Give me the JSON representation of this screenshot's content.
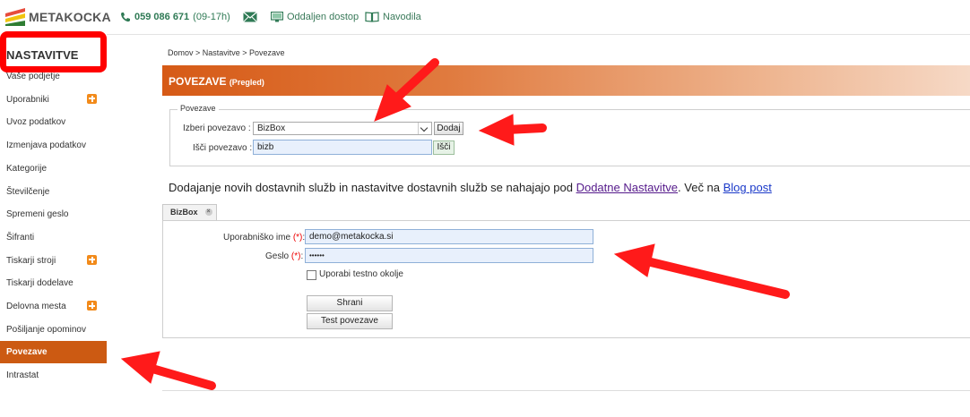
{
  "topbar": {
    "brand": "METAKOCKA",
    "phone_number": "059 086 671",
    "phone_hours": "(09-17h)",
    "remote_access": "Oddaljen dostop",
    "manuals": "Navodila"
  },
  "sidebar": {
    "title": "NASTAVITVE",
    "items": [
      {
        "label": "Vaše podjetje",
        "plus": false,
        "active": false
      },
      {
        "label": "Uporabniki",
        "plus": true,
        "active": false
      },
      {
        "label": "Uvoz podatkov",
        "plus": false,
        "active": false
      },
      {
        "label": "Izmenjava podatkov",
        "plus": false,
        "active": false
      },
      {
        "label": "Kategorije",
        "plus": false,
        "active": false
      },
      {
        "label": "Številčenje",
        "plus": false,
        "active": false
      },
      {
        "label": "Spremeni geslo",
        "plus": false,
        "active": false
      },
      {
        "label": "Šifranti",
        "plus": false,
        "active": false
      },
      {
        "label": "Tiskarji stroji",
        "plus": true,
        "active": false
      },
      {
        "label": "Tiskarji dodelave",
        "plus": false,
        "active": false
      },
      {
        "label": "Delovna mesta",
        "plus": true,
        "active": false
      },
      {
        "label": "Pošiljanje opominov",
        "plus": false,
        "active": false
      },
      {
        "label": "Povezave",
        "plus": false,
        "active": true
      },
      {
        "label": "Intrastat",
        "plus": false,
        "active": false
      }
    ]
  },
  "breadcrumb": "Domov  >  Nastavitve  >  Povezave",
  "header": {
    "title": "POVEZAVE",
    "subtitle": "(Pregled)"
  },
  "connections": {
    "legend": "Povezave",
    "select_label": "Izberi povezavo :",
    "select_value": "BizBox",
    "add_button": "Dodaj",
    "search_label": "Išči povezavo :",
    "search_value": "bizb",
    "search_button": "Išči"
  },
  "info": {
    "text": "Dodajanje novih dostavnih služb in nastavitve dostavnih služb se nahajajo pod ",
    "link1": "Dodatne Nastavitve",
    "middle": ". Več na ",
    "link2": "Blog post"
  },
  "tab": {
    "label": "BizBox"
  },
  "form": {
    "username_label": "Uporabniško ime",
    "username_value": "demo@metakocka.si",
    "password_label": "Geslo",
    "password_value": "••••••",
    "required_mark": "(*)",
    "checkbox_label": "Uporabi testno okolje",
    "save_button": "Shrani",
    "test_button": "Test povezave"
  },
  "colors": {
    "accent": "#cc5a12",
    "annotation": "#ff0000",
    "link": "#1a39c9"
  }
}
